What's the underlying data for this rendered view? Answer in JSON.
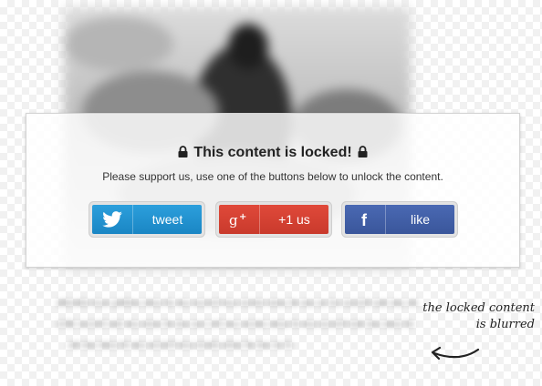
{
  "locker": {
    "title": "This content is locked!",
    "message": "Please support us, use one of the buttons below to unlock the content.",
    "buttons": [
      {
        "label": "tweet",
        "icon": "twitter-bird-icon",
        "color": "#1a86c4"
      },
      {
        "label": "+1 us",
        "icon": "google-plus-icon",
        "color": "#d8432f"
      },
      {
        "label": "like",
        "icon": "facebook-f-icon",
        "color": "#3a569b"
      }
    ]
  },
  "annotation": {
    "line1": "the locked content",
    "line2": "is blurred"
  }
}
